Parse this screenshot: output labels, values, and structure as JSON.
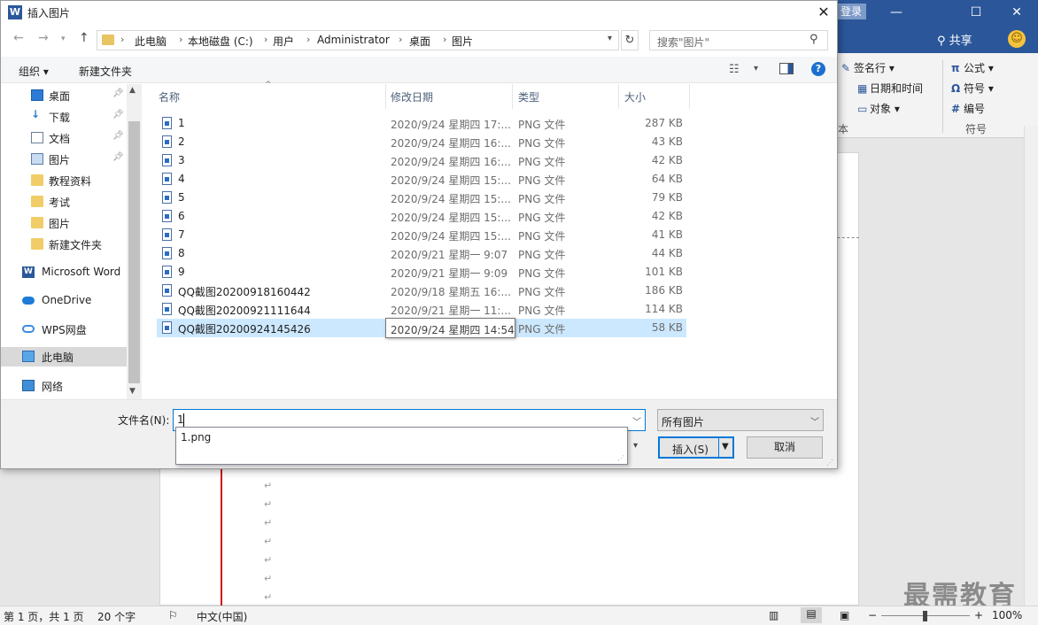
{
  "word": {
    "login_label": "登录",
    "share_label": "共享",
    "ribbon": {
      "signature_line": "签名行",
      "date_time": "日期和时间",
      "object": "对象",
      "text_group_fragment": "本",
      "equation": "公式",
      "symbol": "符号",
      "number": "编号",
      "symbols_group": "符号"
    },
    "status": {
      "page": "第 1 页，共 1 页",
      "words": "20 个字",
      "language": "中文(中国)",
      "zoom": "100%"
    },
    "watermark": "最需教育",
    "window_controls": {
      "minimize": "—",
      "maximize": "☐",
      "close": "✕"
    }
  },
  "dialog": {
    "title": "插入图片",
    "close": "✕",
    "breadcrumb": [
      "此电脑",
      "本地磁盘 (C:)",
      "用户",
      "Administrator",
      "桌面",
      "图片"
    ],
    "search_placeholder": "搜索\"图片\"",
    "toolbar": {
      "organize": "组织",
      "new_folder": "新建文件夹"
    },
    "sidebar": [
      {
        "label": "桌面",
        "icon": "desktop-icon",
        "pinned": true
      },
      {
        "label": "下载",
        "icon": "download-icon",
        "pinned": true
      },
      {
        "label": "文档",
        "icon": "document-icon",
        "pinned": true
      },
      {
        "label": "图片",
        "icon": "pictures-icon",
        "pinned": true
      },
      {
        "label": "教程资料",
        "icon": "folder-icon",
        "pinned": false
      },
      {
        "label": "考试",
        "icon": "folder-icon",
        "pinned": false
      },
      {
        "label": "图片",
        "icon": "folder-icon",
        "pinned": false
      },
      {
        "label": "新建文件夹",
        "icon": "folder-icon",
        "pinned": false
      },
      {
        "label": "Microsoft Word",
        "icon": "word-icon",
        "pinned": false
      },
      {
        "label": "OneDrive",
        "icon": "cloud-icon",
        "pinned": false
      },
      {
        "label": "WPS网盘",
        "icon": "wps-cloud-icon",
        "pinned": false
      },
      {
        "label": "此电脑",
        "icon": "computer-icon",
        "pinned": false
      },
      {
        "label": "网络",
        "icon": "network-icon",
        "pinned": false
      }
    ],
    "columns": {
      "name": "名称",
      "date": "修改日期",
      "type": "类型",
      "size": "大小"
    },
    "files": [
      {
        "name": "1",
        "date": "2020/9/24 星期四 17:...",
        "type": "PNG 文件",
        "size": "287 KB"
      },
      {
        "name": "2",
        "date": "2020/9/24 星期四 16:...",
        "type": "PNG 文件",
        "size": "43 KB"
      },
      {
        "name": "3",
        "date": "2020/9/24 星期四 16:...",
        "type": "PNG 文件",
        "size": "42 KB"
      },
      {
        "name": "4",
        "date": "2020/9/24 星期四 15:...",
        "type": "PNG 文件",
        "size": "64 KB"
      },
      {
        "name": "5",
        "date": "2020/9/24 星期四 15:...",
        "type": "PNG 文件",
        "size": "79 KB"
      },
      {
        "name": "6",
        "date": "2020/9/24 星期四 15:...",
        "type": "PNG 文件",
        "size": "42 KB"
      },
      {
        "name": "7",
        "date": "2020/9/24 星期四 15:...",
        "type": "PNG 文件",
        "size": "41 KB"
      },
      {
        "name": "8",
        "date": "2020/9/21 星期一 9:07",
        "type": "PNG 文件",
        "size": "44 KB"
      },
      {
        "name": "9",
        "date": "2020/9/21 星期一 9:09",
        "type": "PNG 文件",
        "size": "101 KB"
      },
      {
        "name": "QQ截图20200918160442",
        "date": "2020/9/18 星期五 16:...",
        "type": "PNG 文件",
        "size": "186 KB"
      },
      {
        "name": "QQ截图20200921111644",
        "date": "2020/9/21 星期一 11:...",
        "type": "PNG 文件",
        "size": "114 KB"
      },
      {
        "name": "QQ截图20200924145426",
        "date": "",
        "type": "PNG 文件",
        "size": "58 KB"
      }
    ],
    "tooltip": "2020/9/24 星期四 14:54",
    "filename_label": "文件名(N):",
    "filename_value": "1",
    "autocomplete_item": "1.png",
    "filter_value": "所有图片",
    "insert_label": "插入(S)",
    "cancel_label": "取消"
  }
}
